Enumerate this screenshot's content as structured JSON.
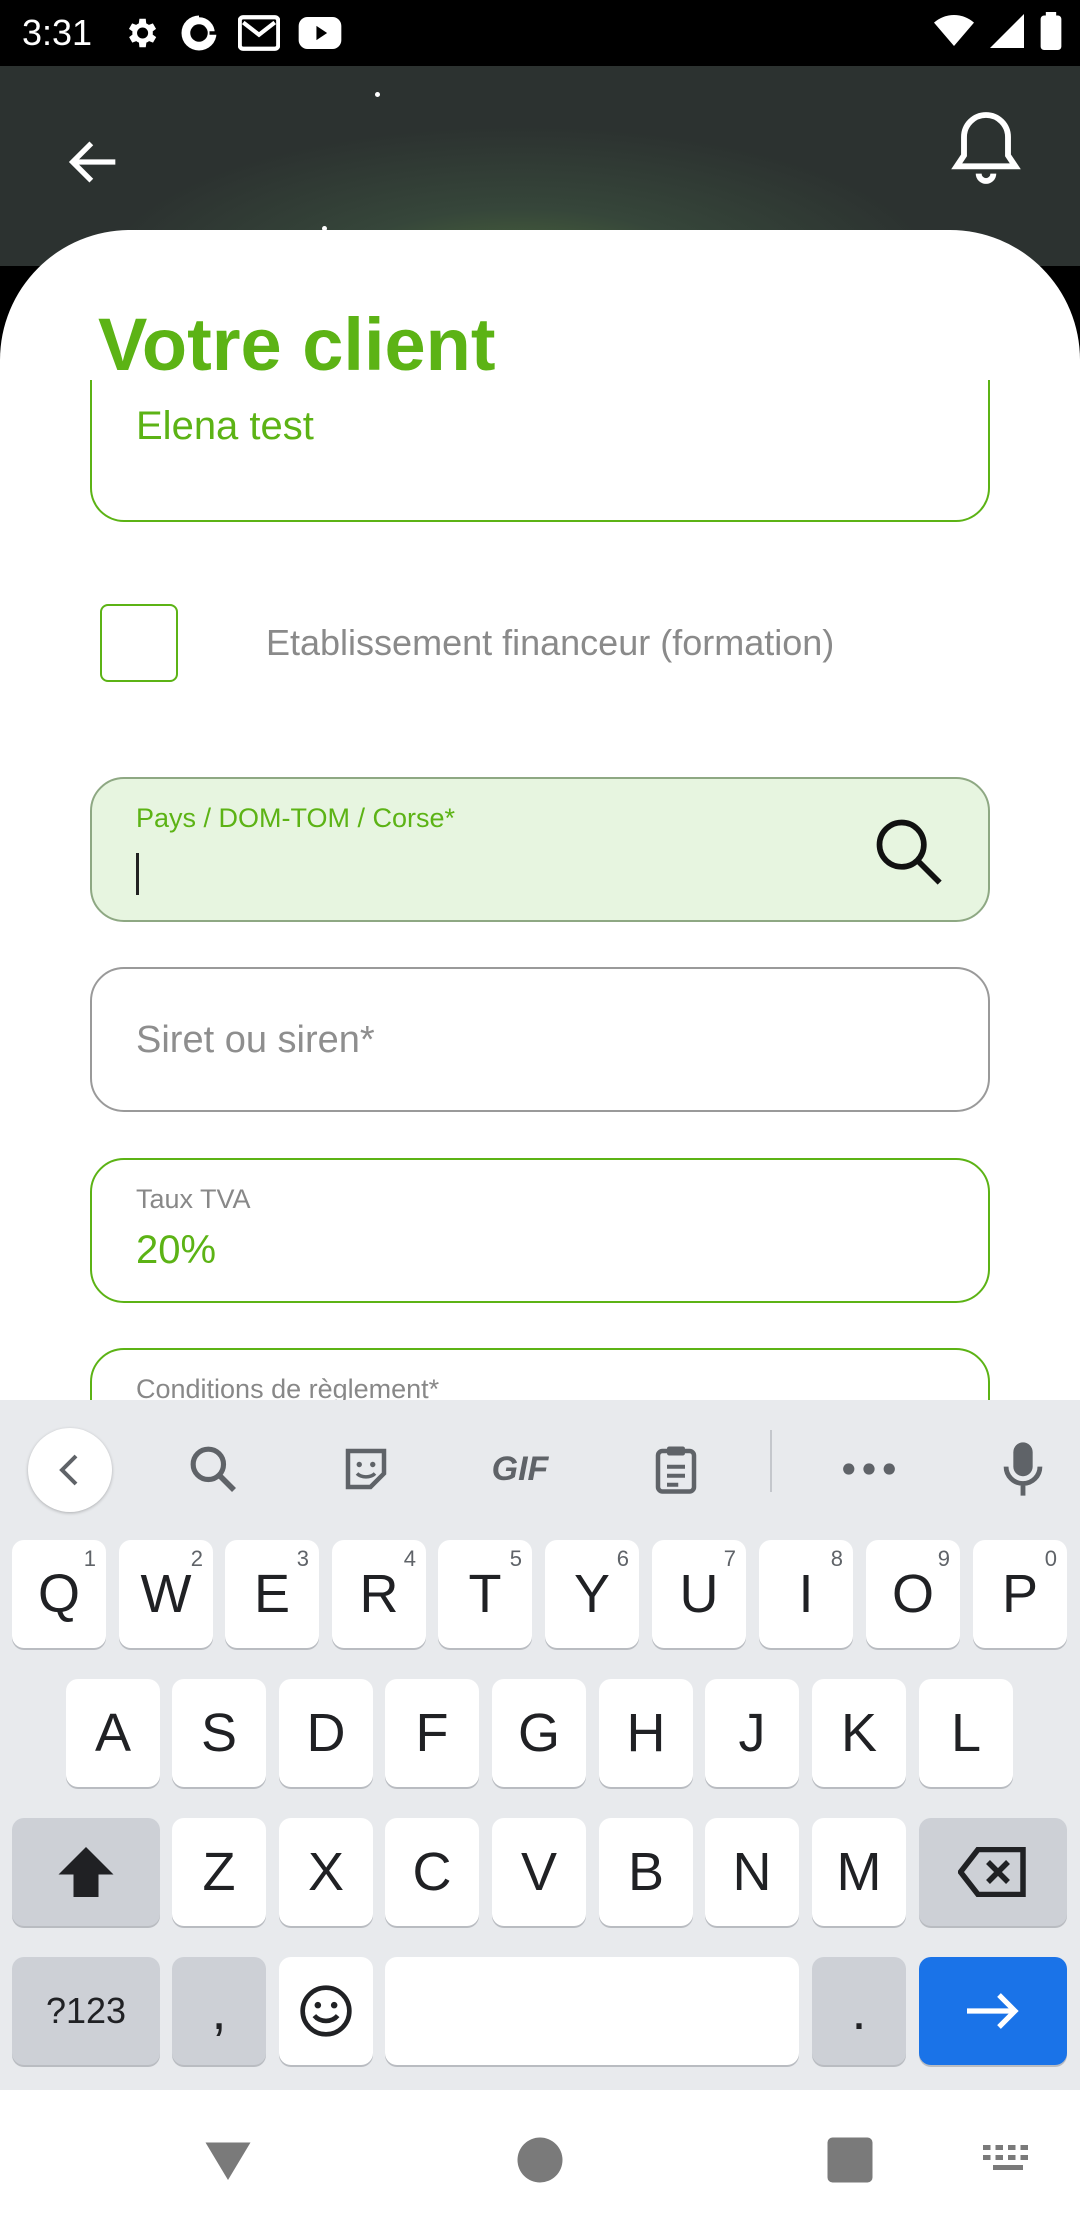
{
  "status_bar": {
    "time": "3:31"
  },
  "header": {
    "back_icon": "arrow-left-icon",
    "notification_icon": "bell-icon"
  },
  "page": {
    "title": "Votre client"
  },
  "form": {
    "client_name_value": "Elena test",
    "financial_checkbox_label": "Etablissement financeur (formation)",
    "financial_checkbox_checked": false,
    "country": {
      "label": "Pays / DOM-TOM / Corse*",
      "value": ""
    },
    "siret": {
      "placeholder": "Siret ou siren*"
    },
    "tva": {
      "label": "Taux TVA",
      "value": "20%"
    },
    "conditions": {
      "label": "Conditions de règlement*"
    }
  },
  "keyboard": {
    "toolbar": [
      "collapse",
      "search",
      "sticker",
      "GIF",
      "clipboard",
      "more",
      "microphone"
    ],
    "gif_label": "GIF",
    "row1": [
      {
        "k": "Q",
        "h": "1"
      },
      {
        "k": "W",
        "h": "2"
      },
      {
        "k": "E",
        "h": "3"
      },
      {
        "k": "R",
        "h": "4"
      },
      {
        "k": "T",
        "h": "5"
      },
      {
        "k": "Y",
        "h": "6"
      },
      {
        "k": "U",
        "h": "7"
      },
      {
        "k": "I",
        "h": "8"
      },
      {
        "k": "O",
        "h": "9"
      },
      {
        "k": "P",
        "h": "0"
      }
    ],
    "row2": [
      "A",
      "S",
      "D",
      "F",
      "G",
      "H",
      "J",
      "K",
      "L"
    ],
    "row3": [
      "Z",
      "X",
      "C",
      "V",
      "B",
      "N",
      "M"
    ],
    "symbols_label": "?123",
    "comma_label": ",",
    "period_label": "."
  },
  "colors": {
    "accent": "#5cb315",
    "field_fill": "#e7f5e0",
    "keyboard_bg": "#e8eaed",
    "enter_key": "#1a73e8"
  }
}
